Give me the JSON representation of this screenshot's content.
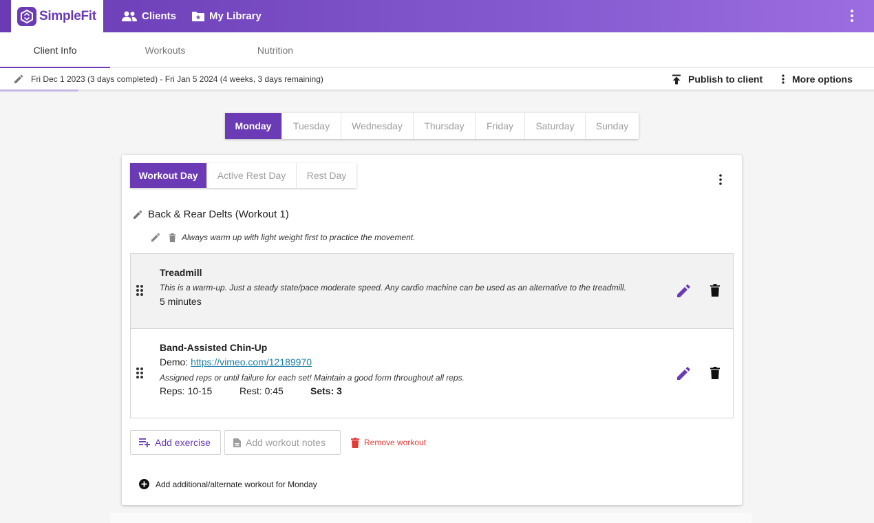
{
  "app": {
    "name": "SimpleFit"
  },
  "topnav": {
    "clients": {
      "label": "Clients",
      "icon": "people-icon"
    },
    "library": {
      "label": "My Library",
      "icon": "folder-star-icon"
    }
  },
  "tabs": [
    {
      "label": "Client Info",
      "active": true
    },
    {
      "label": "Workouts",
      "active": false
    },
    {
      "label": "Nutrition",
      "active": false
    }
  ],
  "program": {
    "date_range": "Fri Dec 1 2023 (3 days completed)  -  Fri Jan 5 2024 (4 weeks, 3 days remaining)",
    "progress_fraction": 0.09,
    "publish_label": "Publish to client",
    "more_label": "More options"
  },
  "days": [
    {
      "label": "Monday",
      "active": true
    },
    {
      "label": "Tuesday",
      "active": false
    },
    {
      "label": "Wednesday",
      "active": false
    },
    {
      "label": "Thursday",
      "active": false
    },
    {
      "label": "Friday",
      "active": false
    },
    {
      "label": "Saturday",
      "active": false
    },
    {
      "label": "Sunday",
      "active": false
    }
  ],
  "day_types": [
    {
      "label": "Workout Day",
      "active": true
    },
    {
      "label": "Active Rest Day",
      "active": false
    },
    {
      "label": "Rest Day",
      "active": false
    }
  ],
  "workout": {
    "title": "Back & Rear Delts (Workout 1)",
    "note": "Always warm up with light weight first to practice the movement."
  },
  "exercises": [
    {
      "name": "Treadmill",
      "description": "This is a warm-up. Just a steady state/pace moderate speed. Any cardio machine can be used as an alternative to the treadmill.",
      "duration": "5 minutes"
    },
    {
      "name": "Band-Assisted Chin-Up",
      "demo_label": "Demo:",
      "demo_link": "https://vimeo.com/12189970",
      "description": "Assigned reps or until failure for each set! Maintain a good form throughout all reps.",
      "reps": "Reps: 10-15",
      "rest": "Rest: 0:45",
      "sets": "Sets: 3"
    }
  ],
  "actions": {
    "add_exercise": "Add exercise",
    "add_notes": "Add workout notes",
    "remove_workout": "Remove workout",
    "add_alternate": "Add additional/alternate workout for Monday"
  },
  "colors": {
    "accent": "#6a3bb4",
    "danger": "#e53935",
    "link": "#1a7fa8"
  }
}
